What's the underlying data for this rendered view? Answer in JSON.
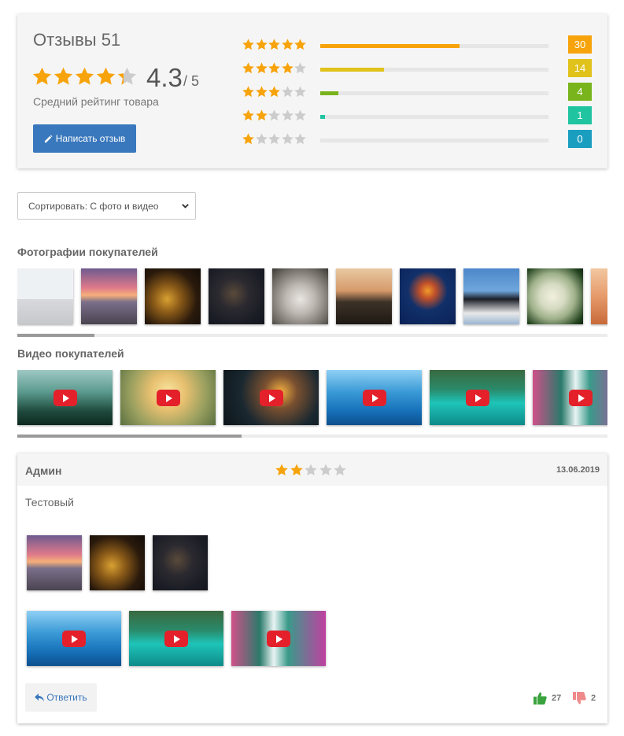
{
  "summary": {
    "title": "Отзывы 51",
    "average": "4.3",
    "average_max": "/ 5",
    "average_rating_value": 4.3,
    "caption": "Средний рейтинг товара",
    "write_button_label": "Написать отзыв",
    "distribution": [
      {
        "stars": 5,
        "count": "30",
        "fraction": 0.61,
        "color": "#f7a30b"
      },
      {
        "stars": 4,
        "count": "14",
        "fraction": 0.28,
        "color": "#e0c21b"
      },
      {
        "stars": 3,
        "count": "4",
        "fraction": 0.08,
        "color": "#79b41c"
      },
      {
        "stars": 2,
        "count": "1",
        "fraction": 0.02,
        "color": "#20c4a0"
      },
      {
        "stars": 1,
        "count": "0",
        "fraction": 0.0,
        "color": "#1a9ec0"
      }
    ]
  },
  "sort": {
    "selected": "Сортировать: С фото и видео"
  },
  "photos_section": {
    "title": "Фотографии покупателей",
    "items": [
      "computer-desk-photo",
      "sunset-pier-photo",
      "golden-dragon-photo",
      "dark-rope-photo",
      "koala-photo",
      "forest-dusk-photo",
      "jellyfish-photo",
      "penguins-photo",
      "hydrangea-photo",
      "desert-photo"
    ],
    "scroll_position": 0.13
  },
  "videos_section": {
    "title": "Видео покупателей",
    "items": [
      "misty-forest-video",
      "meditating-monk-video",
      "butterfly-forest-video",
      "dolphins-video",
      "emerald-pool-video",
      "waterfall-video"
    ],
    "scroll_position": 0.38
  },
  "review": {
    "author": "Админ",
    "rating": 2,
    "date": "13.06.2019",
    "text": "Тестовый",
    "photos": [
      "sunset-pier-photo",
      "golden-dragon-photo",
      "dark-rope-photo"
    ],
    "videos": [
      "dolphins-video",
      "emerald-pool-video",
      "waterfall-video"
    ],
    "reply_label": "Ответить",
    "likes": "27",
    "dislikes": "2"
  },
  "colors": {
    "star_filled": "#f7a30b",
    "star_empty": "#cccccc",
    "primary": "#3a78bd",
    "like": "#3aa33e",
    "dislike": "#ef8a8a"
  }
}
